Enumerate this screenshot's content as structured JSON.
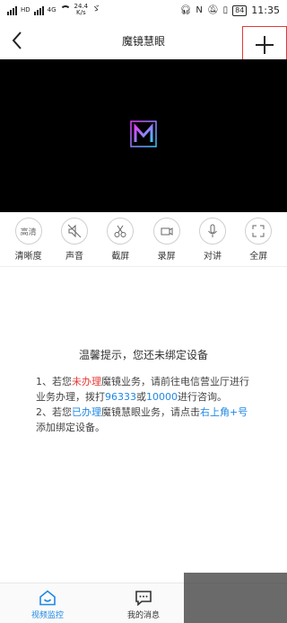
{
  "status_bar": {
    "network_1": "HD",
    "network_2": "4G",
    "speed_value": "24.4",
    "speed_unit": "K/s",
    "battery": "84",
    "time": "11:35"
  },
  "header": {
    "title": "魔镜慧眼"
  },
  "controls": [
    {
      "label": "清晰度",
      "icon_text": "高清"
    },
    {
      "label": "声音"
    },
    {
      "label": "截屏"
    },
    {
      "label": "录屏"
    },
    {
      "label": "对讲"
    },
    {
      "label": "全屏"
    }
  ],
  "notice": {
    "title": "温馨提示，您还未绑定设备",
    "p1_a": "1、若您",
    "p1_b": "未办理",
    "p1_c": "魔镜业务，请前往电信营业厅进行业务办理，拨打",
    "p1_d": "96333",
    "p1_e": "或",
    "p1_f": "10000",
    "p1_g": "进行咨询。",
    "p2_a": "2、若您",
    "p2_b": "已办理",
    "p2_c": "魔镜慧眼业务，请点击",
    "p2_d": "右上角+号",
    "p2_e": "添加绑定设备。"
  },
  "tabs": [
    {
      "label": "视频监控"
    },
    {
      "label": "我的消息"
    }
  ],
  "colors": {
    "accent": "#1e88e5",
    "warning": "#e53935"
  }
}
